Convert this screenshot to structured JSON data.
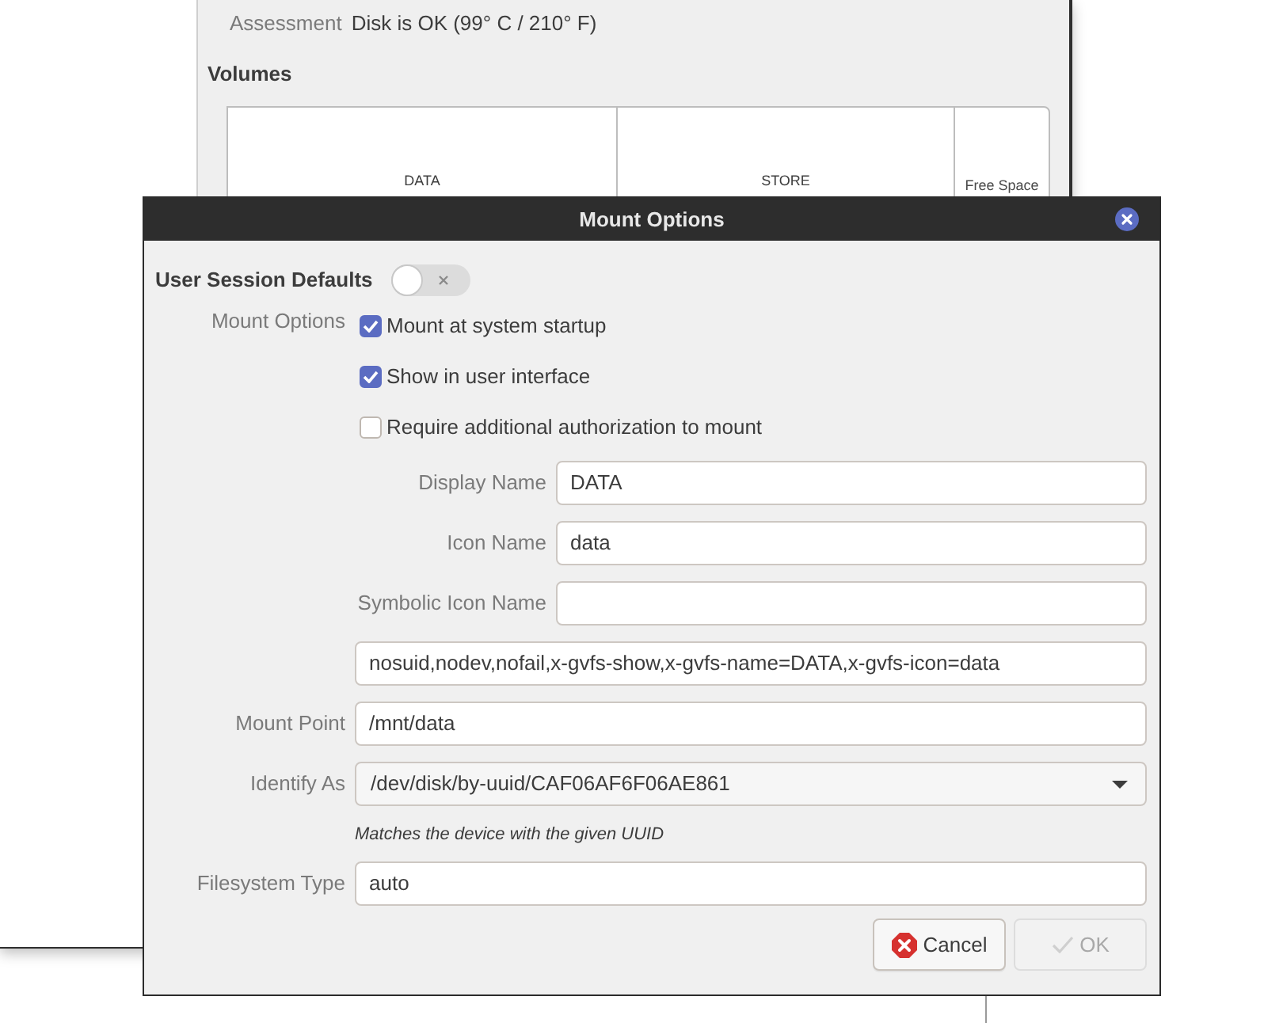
{
  "background_window": {
    "assessment": {
      "label": "Assessment",
      "value": "Disk is OK (99° C / 210° F)"
    },
    "volumes_heading": "Volumes",
    "volumes": [
      {
        "kind": "partition",
        "label": "DATA"
      },
      {
        "kind": "partition",
        "label": "STORE"
      },
      {
        "kind": "free",
        "label": "Free Space"
      }
    ]
  },
  "dialog": {
    "title": "Mount Options",
    "user_session_defaults": {
      "label": "User Session Defaults",
      "on": false
    },
    "mount_options": {
      "label": "Mount Options",
      "checkboxes": [
        {
          "label": "Mount at system startup",
          "checked": true
        },
        {
          "label": "Show in user interface",
          "checked": true
        },
        {
          "label": "Require additional authorization to mount",
          "checked": false
        }
      ],
      "names": [
        {
          "label": "Display Name",
          "value": "DATA"
        },
        {
          "label": "Icon Name",
          "value": "data"
        },
        {
          "label": "Symbolic Icon Name"
        }
      ],
      "options_value": "nosuid,nodev,nofail,x-gvfs-show,x-gvfs-name=DATA,x-gvfs-icon=data"
    },
    "fields": [
      {
        "kind": "entry",
        "label": "Mount Point",
        "value": "/mnt/data"
      },
      {
        "kind": "combo",
        "label": "Identify As",
        "value": "/dev/disk/by-uuid/CAF06AF6F06AE861",
        "hint": "Matches the device with the given UUID"
      },
      {
        "kind": "entry",
        "label": "Filesystem Type",
        "value": "auto"
      }
    ],
    "buttons": [
      {
        "kind": "cancel",
        "label": "Cancel",
        "disabled": false
      },
      {
        "kind": "ok",
        "label": "OK",
        "disabled": true
      }
    ]
  }
}
